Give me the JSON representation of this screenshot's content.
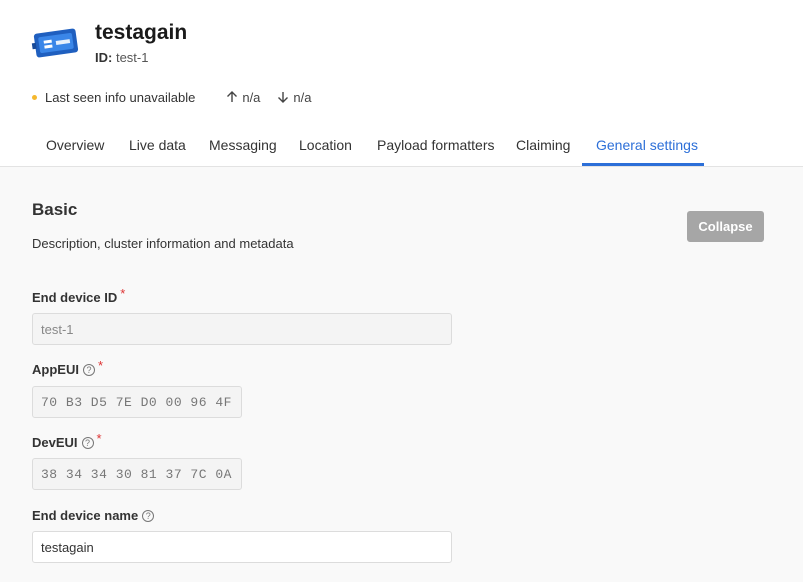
{
  "device": {
    "title": "testagain",
    "id_label": "ID:",
    "id_value": "test-1"
  },
  "status": {
    "last_seen": "Last seen info unavailable",
    "uplink": "n/a",
    "downlink": "n/a"
  },
  "tabs": [
    {
      "label": "Overview"
    },
    {
      "label": "Live data"
    },
    {
      "label": "Messaging"
    },
    {
      "label": "Location"
    },
    {
      "label": "Payload formatters"
    },
    {
      "label": "Claiming"
    },
    {
      "label": "General settings",
      "active": true
    }
  ],
  "section": {
    "title": "Basic",
    "description": "Description, cluster information and metadata",
    "collapse_label": "Collapse"
  },
  "fields": {
    "end_device_id": {
      "label": "End device ID",
      "value": "test-1"
    },
    "app_eui": {
      "label": "AppEUI",
      "value": "70 B3 D5 7E D0 00 96 4F"
    },
    "dev_eui": {
      "label": "DevEUI",
      "value": "38 34 34 30 81 37 7C 0A"
    },
    "end_device_name": {
      "label": "End device name",
      "value": "testagain"
    }
  },
  "colors": {
    "accent": "#2c6fd8",
    "status_dot": "#f5b82e",
    "required": "#dd3333",
    "collapse_button": "#a6a6a6"
  },
  "icons": [
    "device-icon",
    "arrow-up-icon",
    "arrow-down-icon",
    "help-icon"
  ]
}
